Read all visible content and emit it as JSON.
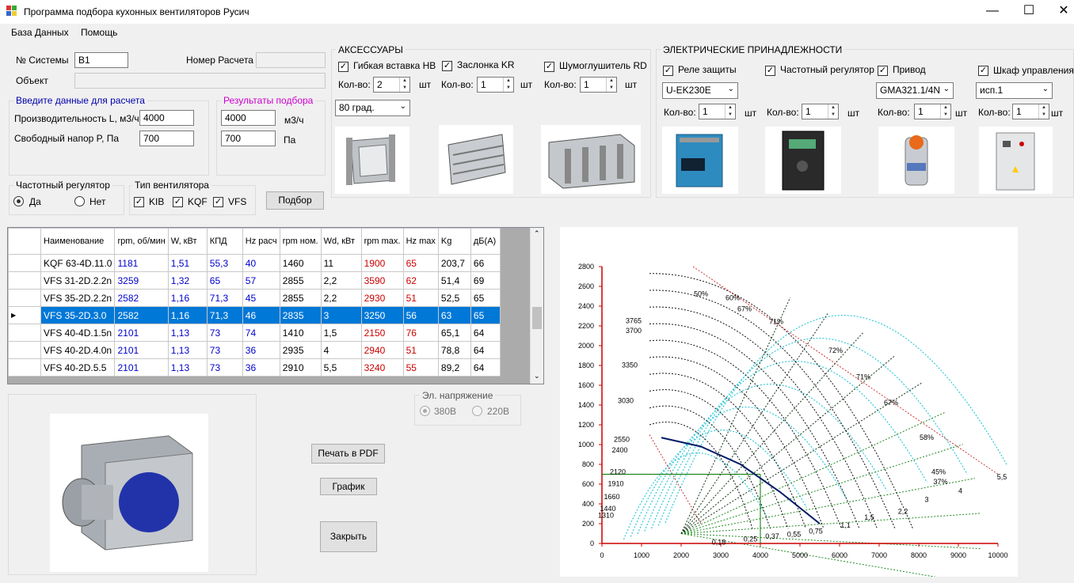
{
  "window": {
    "title": "Программа подбора кухонных вентиляторов Русич",
    "minimize": "—",
    "maximize": "☐",
    "close": "✕"
  },
  "menu": [
    "База Данных",
    "Помощь"
  ],
  "system": {
    "label": "№ Системы",
    "value": "B1",
    "calc_label": "Номер Расчета",
    "calc_value": "",
    "object_label": "Объект",
    "object_value": ""
  },
  "input": {
    "title": "Введите  данные для расчета",
    "flow_label": "Производительность L, м3/ч",
    "flow_value": "4000",
    "pressure_label": "Свободный напор P, Па",
    "pressure_value": "700"
  },
  "results": {
    "title": "Результаты подбора",
    "flow_value": "4000",
    "flow_unit": "м3/ч",
    "pressure_value": "700",
    "pressure_unit": "Па"
  },
  "freq": {
    "title": "Частотный регулятор",
    "yes": "Да",
    "no": "Нет"
  },
  "fantype": {
    "title": "Тип вентилятора",
    "items": [
      "KIB",
      "KQF",
      "VFS"
    ]
  },
  "select_button": "Подбор",
  "accessories": {
    "title": "АКСЕССУАРЫ",
    "items": [
      {
        "label": "Гибкая вставка НВ",
        "qty_label": "Кол-во:",
        "qty": "2",
        "unit": "шт"
      },
      {
        "label": "Заслонка KR",
        "qty_label": "Кол-во:",
        "qty": "1",
        "unit": "шт"
      },
      {
        "label": "Шумоглушитель RD",
        "qty_label": "Кол-во:",
        "qty": "1",
        "unit": "шт"
      }
    ],
    "temp_option": "80 град."
  },
  "electrical": {
    "title": "ЭЛЕКТРИЧЕСКИЕ ПРИНАДЛЕЖНОСТИ",
    "items": [
      {
        "label": "Реле защиты",
        "model": "U-EK230E",
        "qty_label": "Кол-во:",
        "qty": "1",
        "unit": "шт"
      },
      {
        "label": "Частотный регулятор",
        "model": "",
        "qty_label": "Кол-во:",
        "qty": "1",
        "unit": "шт"
      },
      {
        "label": "Привод",
        "model": "GMA321.1/4N",
        "qty_label": "Кол-во:",
        "qty": "1",
        "unit": "шт"
      },
      {
        "label": "Шкаф управления",
        "model": "исп.1",
        "qty_label": "Кол-во:",
        "qty": "1",
        "unit": "шт"
      }
    ]
  },
  "table": {
    "headers": [
      "Наименование",
      "rpm, об/мин",
      "W, кВт",
      "КПД",
      "Hz расч",
      "rpm ном.",
      "Wd, кВт",
      "rpm max.",
      "Hz max",
      "Kg",
      "дБ(А)"
    ],
    "rows": [
      [
        "KQF 63-4D.11.0",
        "1181",
        "1,51",
        "55,3",
        "40",
        "1460",
        "11",
        "1900",
        "65",
        "203,7",
        "66"
      ],
      [
        "VFS 31-2D.2.2n",
        "3259",
        "1,32",
        "65",
        "57",
        "2855",
        "2,2",
        "3590",
        "62",
        "51,4",
        "69"
      ],
      [
        "VFS 35-2D.2.2n",
        "2582",
        "1,16",
        "71,3",
        "45",
        "2855",
        "2,2",
        "2930",
        "51",
        "52,5",
        "65"
      ],
      [
        "VFS 35-2D.3.0",
        "2582",
        "1,16",
        "71,3",
        "46",
        "2835",
        "3",
        "3250",
        "56",
        "63",
        "65"
      ],
      [
        "VFS 40-4D.1.5n",
        "2101",
        "1,13",
        "73",
        "74",
        "1410",
        "1,5",
        "2150",
        "76",
        "65,1",
        "64"
      ],
      [
        "VFS 40-2D.4.0n",
        "2101",
        "1,13",
        "73",
        "36",
        "2935",
        "4",
        "2940",
        "51",
        "78,8",
        "64"
      ],
      [
        "VFS 40-2D.5.5",
        "2101",
        "1,13",
        "73",
        "36",
        "2910",
        "5,5",
        "3240",
        "55",
        "89,2",
        "64"
      ]
    ],
    "selected_row": 3
  },
  "voltage": {
    "title": "Эл. напряжение",
    "v380": "380В",
    "v220": "220В"
  },
  "buttons": {
    "pdf": "Печать в PDF",
    "graph": "График",
    "close": "Закрыть"
  },
  "chart_data": {
    "type": "line",
    "xlim": [
      0,
      10000
    ],
    "ylim": [
      0,
      2800
    ],
    "x_ticks": [
      "0",
      "1000",
      "2000",
      "3000",
      "4000",
      "5000",
      "6000",
      "7000",
      "8000",
      "9000",
      "10000"
    ],
    "y_ticks": [
      "0",
      "200",
      "400",
      "600",
      "800",
      "1000",
      "1200",
      "1400",
      "1600",
      "1800",
      "2000",
      "2200",
      "2400",
      "2600",
      "2800"
    ],
    "rpm_labels": [
      "3765",
      "3700",
      "3350",
      "3030",
      "2550",
      "2400",
      "2120",
      "1910",
      "1660",
      "1440",
      "1310"
    ],
    "efficiency_labels": [
      "50%",
      "60%",
      "67%",
      "71%",
      "72%",
      "71%",
      "67%",
      "58%",
      "45%",
      "37%"
    ],
    "power_labels": [
      "0,18",
      "0,25",
      "0,37",
      "0,55",
      "0,75",
      "1,1",
      "1,5",
      "2,2",
      "3",
      "4",
      "5,5"
    ],
    "series": [
      {
        "x": [
          1500,
          2500,
          3500,
          4500,
          5500
        ],
        "y": [
          1070,
          980,
          800,
          520,
          200
        ]
      }
    ],
    "operating_point": {
      "x": 4000,
      "y": 700
    },
    "grid": false
  }
}
